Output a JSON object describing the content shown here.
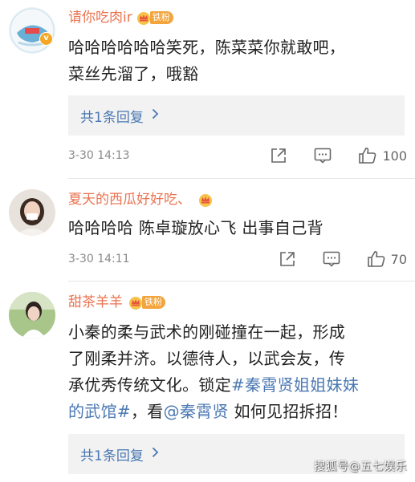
{
  "comments": [
    {
      "username": "请你吃肉ir",
      "fan_badge": "铁粉",
      "text_lines": [
        "哈哈哈哈哈哈笑死，陈菜菜你就敢吧，",
        "菜丝先溜了，哦豁"
      ],
      "reply_label": "共1条回复",
      "timestamp": "3-30 14:13",
      "like_count": "100"
    },
    {
      "username": "夏天的西瓜好好吃、",
      "text_lines": [
        "哈哈哈哈 陈卓璇放心飞 出事自己背"
      ],
      "timestamp": "3-30 14:11",
      "like_count": "70"
    },
    {
      "username": "甜茶羊羊",
      "fan_badge": "铁粉",
      "text_parts": {
        "line1": "小秦的柔与武术的刚碰撞在一起，形成",
        "line2": "了刚柔并济。以德待人，以武会友，传",
        "line3_a": "承优秀传统文化。锁定",
        "line3_tag": "#秦霄贤姐姐妹妹",
        "line4_tag": "的武馆#",
        "line4_b": "，看",
        "line4_mention": "@秦霄贤",
        "line4_c": " 如何见招拆招！"
      },
      "reply_label": "共1条回复"
    }
  ],
  "watermark": "搜狐号@五七娱乐",
  "colors": {
    "username": "#eb7350",
    "link": "#4a78b3",
    "fan_badge": "#f3a43b",
    "reply_bg": "#f2f2f2"
  },
  "icons": [
    "verified-v-icon",
    "crown-icon",
    "chevron-right-icon",
    "share-icon",
    "comment-icon",
    "like-icon"
  ]
}
